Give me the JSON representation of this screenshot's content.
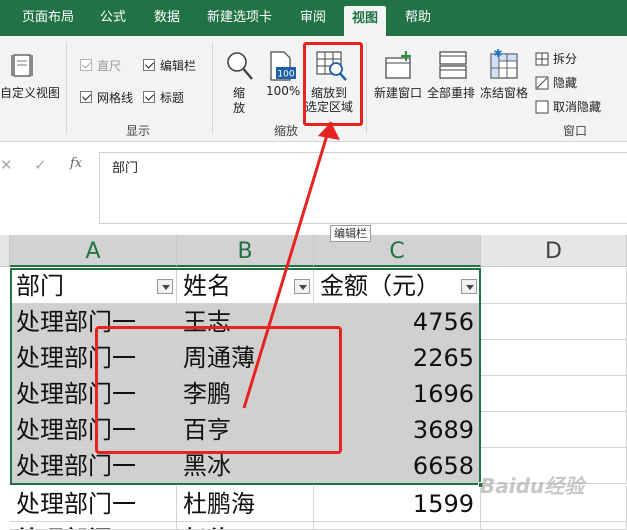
{
  "tabs": [
    {
      "label": "页面布局",
      "active": false
    },
    {
      "label": "公式",
      "active": false
    },
    {
      "label": "数据",
      "active": false
    },
    {
      "label": "新建选项卡",
      "active": false
    },
    {
      "label": "审阅",
      "active": false
    },
    {
      "label": "视图",
      "active": true
    },
    {
      "label": "帮助",
      "active": false
    }
  ],
  "ribbon": {
    "custom_view": "自定义视图",
    "show_group": {
      "label": "显示",
      "ruler": "直尺",
      "formula_bar": "编辑栏",
      "gridlines": "网格线",
      "headings": "标题"
    },
    "zoom_group": {
      "label": "缩放",
      "zoom": "缩放",
      "zoom_100": "100%",
      "zoom_100_icon": "100",
      "zoom_selection_line1": "缩放到",
      "zoom_selection_line2": "选定区域"
    },
    "window_group": {
      "label": "窗口",
      "new_window": "新建窗口",
      "arrange_all": "全部重排",
      "freeze_panes": "冻结窗格",
      "split": "拆分",
      "hide": "隐藏",
      "unhide": "取消隐藏"
    }
  },
  "formula_bar": {
    "fx": "fx",
    "content": "部门",
    "tooltip": "编辑栏"
  },
  "columns": [
    "A",
    "B",
    "C",
    "D"
  ],
  "table": {
    "headers": [
      "部门",
      "姓名",
      "金额（元）"
    ],
    "rows": [
      [
        "处理部门一",
        "王志",
        "4756"
      ],
      [
        "处理部门一",
        "周通薄",
        "2265"
      ],
      [
        "处理部门一",
        "李鹏",
        "1696"
      ],
      [
        "处理部门一",
        "百亨",
        "3689"
      ],
      [
        "处理部门一",
        "黑冰",
        "6658"
      ],
      [
        "处理部门一",
        "杜鹏海",
        "1599"
      ],
      [
        "处理部门一",
        "赵伟",
        ""
      ]
    ]
  },
  "watermark": "Baidu经验",
  "colors": {
    "accent": "#217346",
    "annotation": "#e8231f",
    "selection": "#d0d0d0"
  }
}
